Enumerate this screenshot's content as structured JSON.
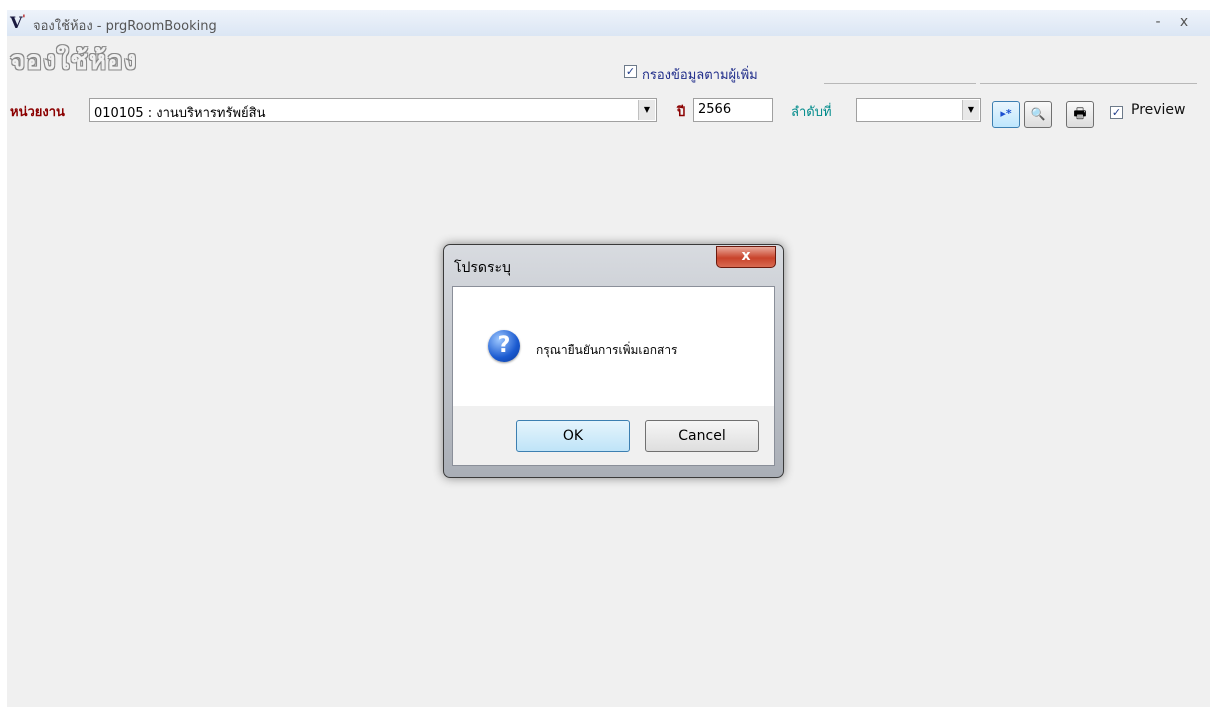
{
  "window": {
    "title": "จองใช้ห้อง - prgRoomBooking",
    "logo_letter": "V",
    "logo_mark": "'",
    "minimize_label": "-",
    "close_label": "x"
  },
  "form": {
    "heading": "จองใช้ห้อง",
    "filter_checkbox_label": "กรองข้อมูลตามผู้เพิ่ม",
    "filter_checked": true,
    "unit_label": "หน่วยงาน",
    "unit_value": "010105 : งานบริหารทรัพย์สิน",
    "year_label": "ปี",
    "year_value": "2566",
    "sequence_label": "ลำดับที่",
    "sequence_value": "",
    "preview_label": "Preview",
    "preview_checked": true
  },
  "toolbar": {
    "icons": [
      "new-record-icon",
      "binoculars-icon",
      "printer-icon"
    ],
    "new_glyph": "▸*",
    "find_glyph": "🔍",
    "print_glyph": "🖶"
  },
  "dialog": {
    "title": "โปรดระบุ",
    "close_glyph": "x",
    "icon_glyph": "?",
    "message": "กรุณายืนยันการเพิ่มเอกสาร",
    "ok_label": "OK",
    "cancel_label": "Cancel"
  },
  "colors": {
    "label_red": "#8b0000",
    "label_teal": "#008b8b",
    "accent_blue": "#1f2c8a",
    "close_red": "#c8432b"
  }
}
